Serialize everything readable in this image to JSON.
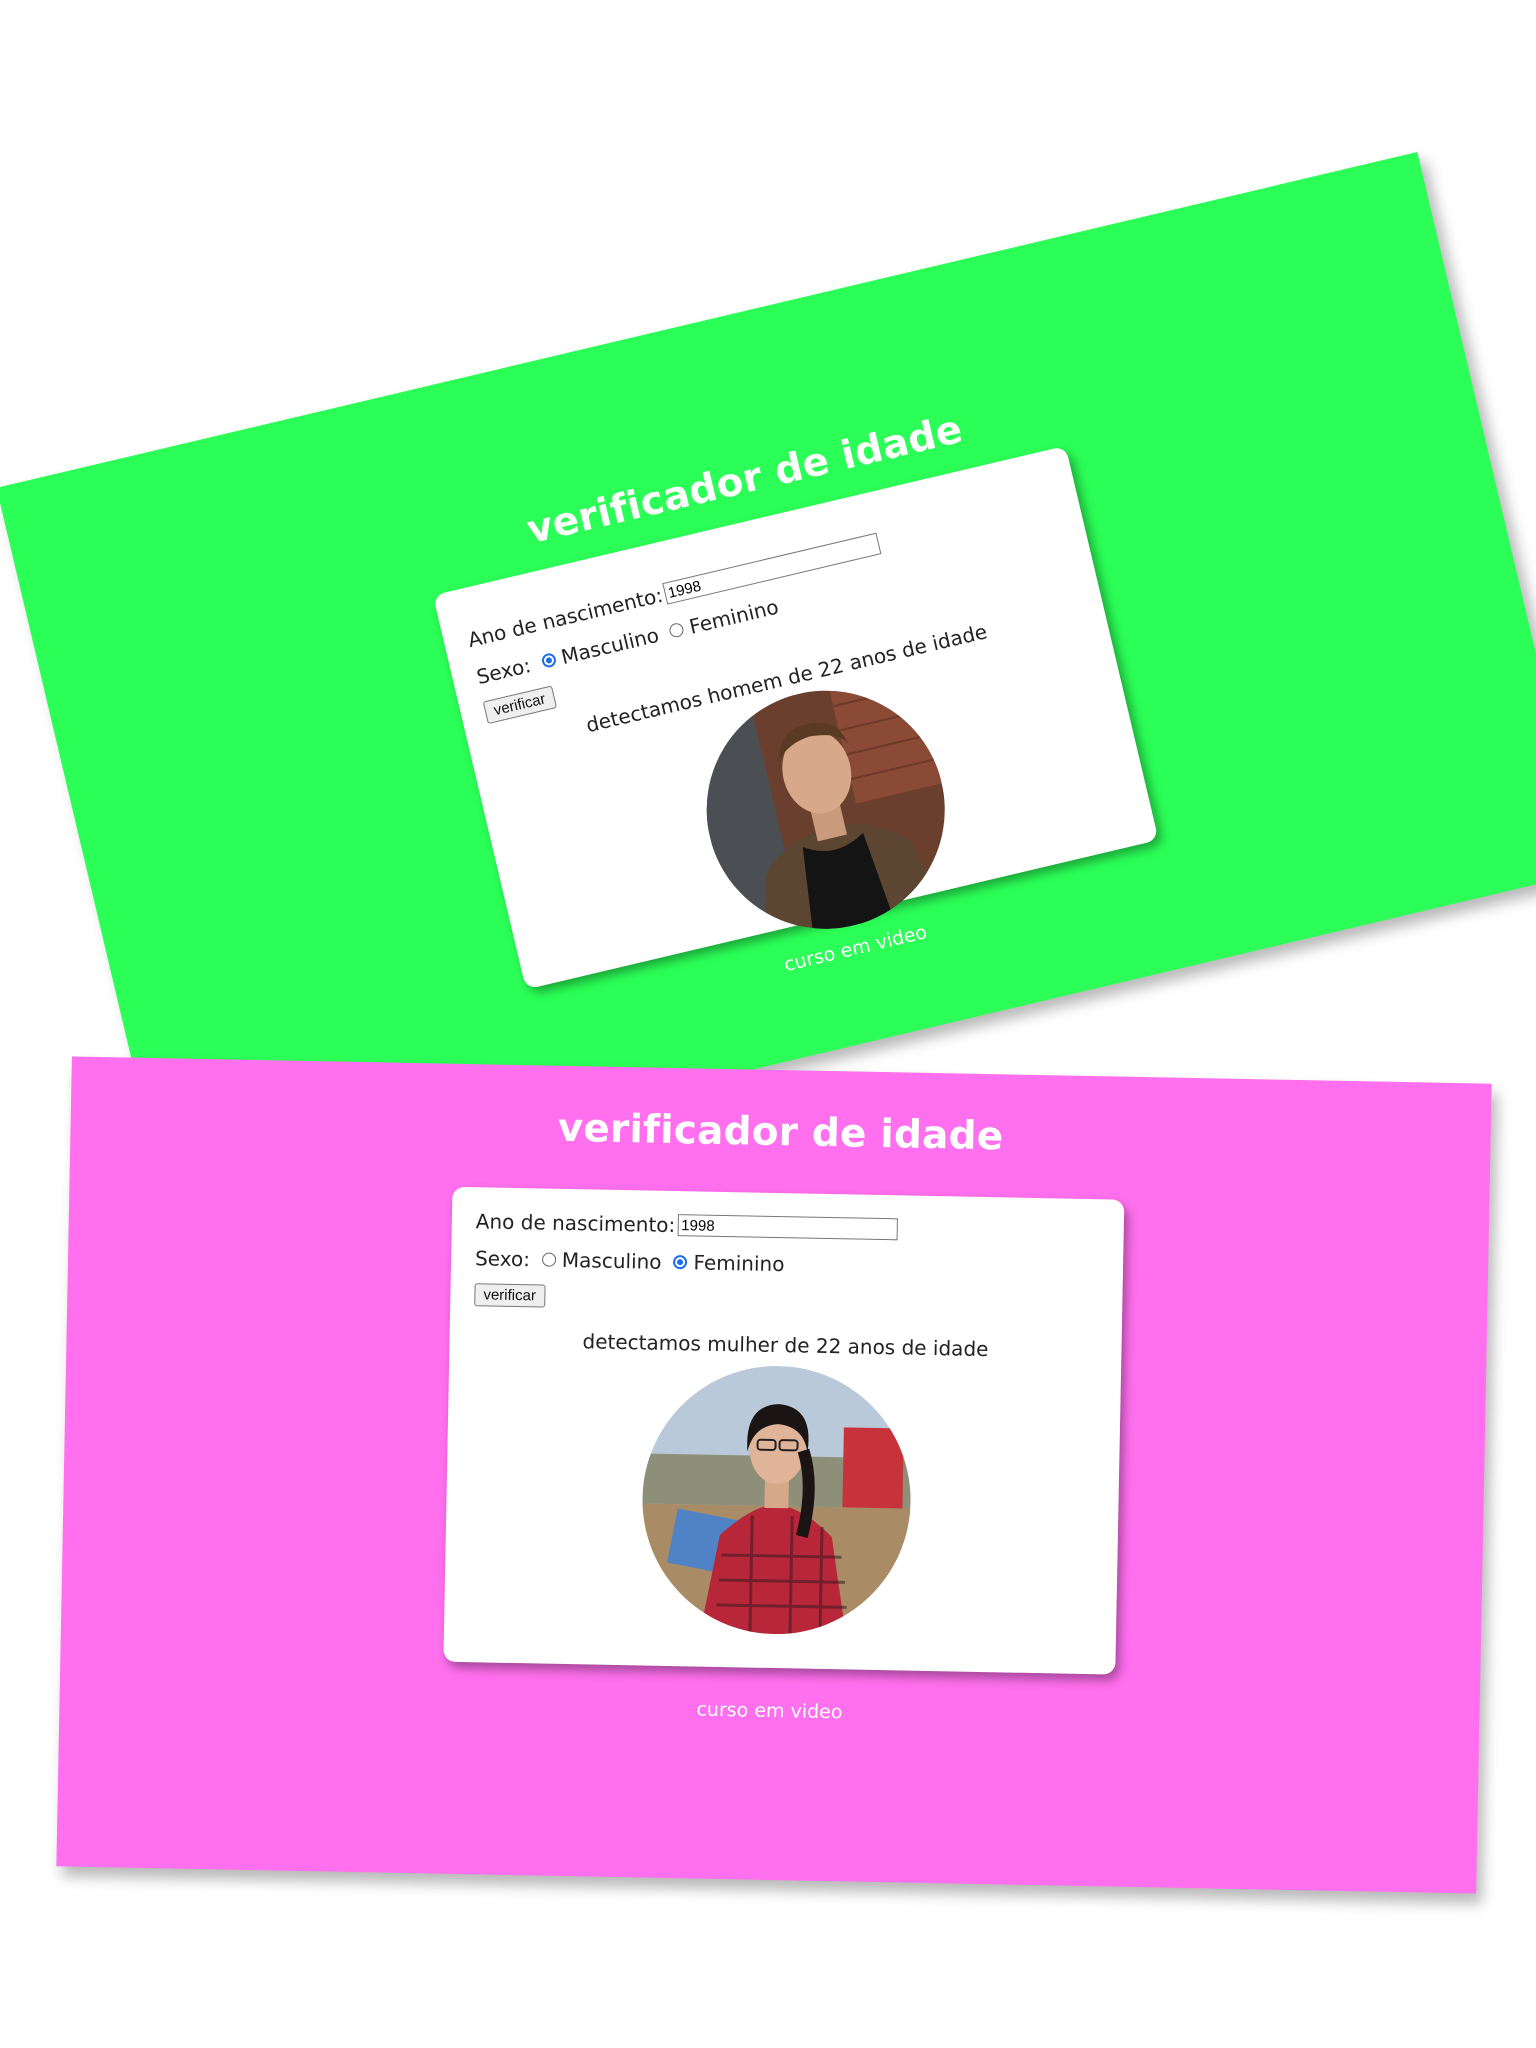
{
  "screens": [
    {
      "theme_color": "#2bff57",
      "title": "verificador de idade",
      "form": {
        "year_label": "Ano de nascimento:",
        "year_value": "1998",
        "sex_label": "Sexo:",
        "option_male": "Masculino",
        "option_female": "Feminino",
        "selected": "Masculino",
        "button_label": "verificar"
      },
      "result_text": "detectamos homem de 22 anos de idade",
      "avatar_icon": "man-photo",
      "footer": "curso em video"
    },
    {
      "theme_color": "#ff6fee",
      "title": "verificador de idade",
      "form": {
        "year_label": "Ano de nascimento:",
        "year_value": "1998",
        "sex_label": "Sexo:",
        "option_male": "Masculino",
        "option_female": "Feminino",
        "selected": "Feminino",
        "button_label": "verificar"
      },
      "result_text": "detectamos mulher de 22 anos de idade",
      "avatar_icon": "woman-photo",
      "footer": "curso em video"
    }
  ]
}
